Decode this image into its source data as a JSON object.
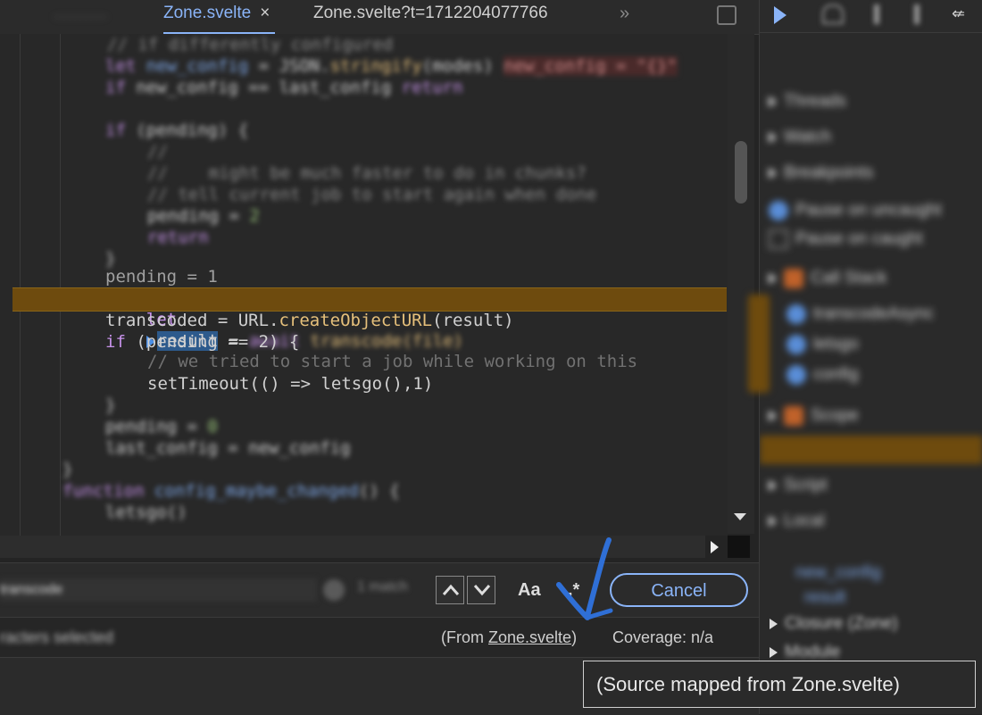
{
  "tabs": {
    "active": "Zone.svelte",
    "active_close": "×",
    "second": "Zone.svelte?t=1712204077766",
    "more": "»"
  },
  "code": {
    "paused_line": {
      "kw_let": "let",
      "var_result": "result",
      "op": " = ",
      "kw_await": "await",
      "rest": "transcode(file)"
    },
    "line_pending": "pending = 1",
    "line_transcoded_a": "transcoded = URL.",
    "line_transcoded_fn": "createObjectURL",
    "line_transcoded_b": "(result)",
    "line_if_kw": "if",
    "line_if_rest": " (pending == 2) {",
    "line_comment": "// we tried to start a job while working on this",
    "line_timeout": "setTimeout(() => letsgo(),1)",
    "line_close_brace": "}"
  },
  "search": {
    "value": "transcode",
    "case_label": "Aa",
    "regex_label": ".*",
    "cancel_label": "Cancel"
  },
  "status": {
    "selected": "racters selected",
    "from_prefix": "(From ",
    "from_link": "Zone.svelte",
    "from_suffix": ")",
    "coverage": "Coverage: n/a"
  },
  "tooltip": {
    "text": "(Source mapped from Zone.svelte)"
  },
  "debugger": {
    "threads": "Threads",
    "watch": "Watch",
    "breakpoints": "Breakpoints",
    "closure": "Closure (Zone)",
    "module": "Module"
  },
  "colors": {
    "accent": "#8ab4f8",
    "paused_line": "#6e4b0e",
    "annotation": "#2f6fd6"
  }
}
